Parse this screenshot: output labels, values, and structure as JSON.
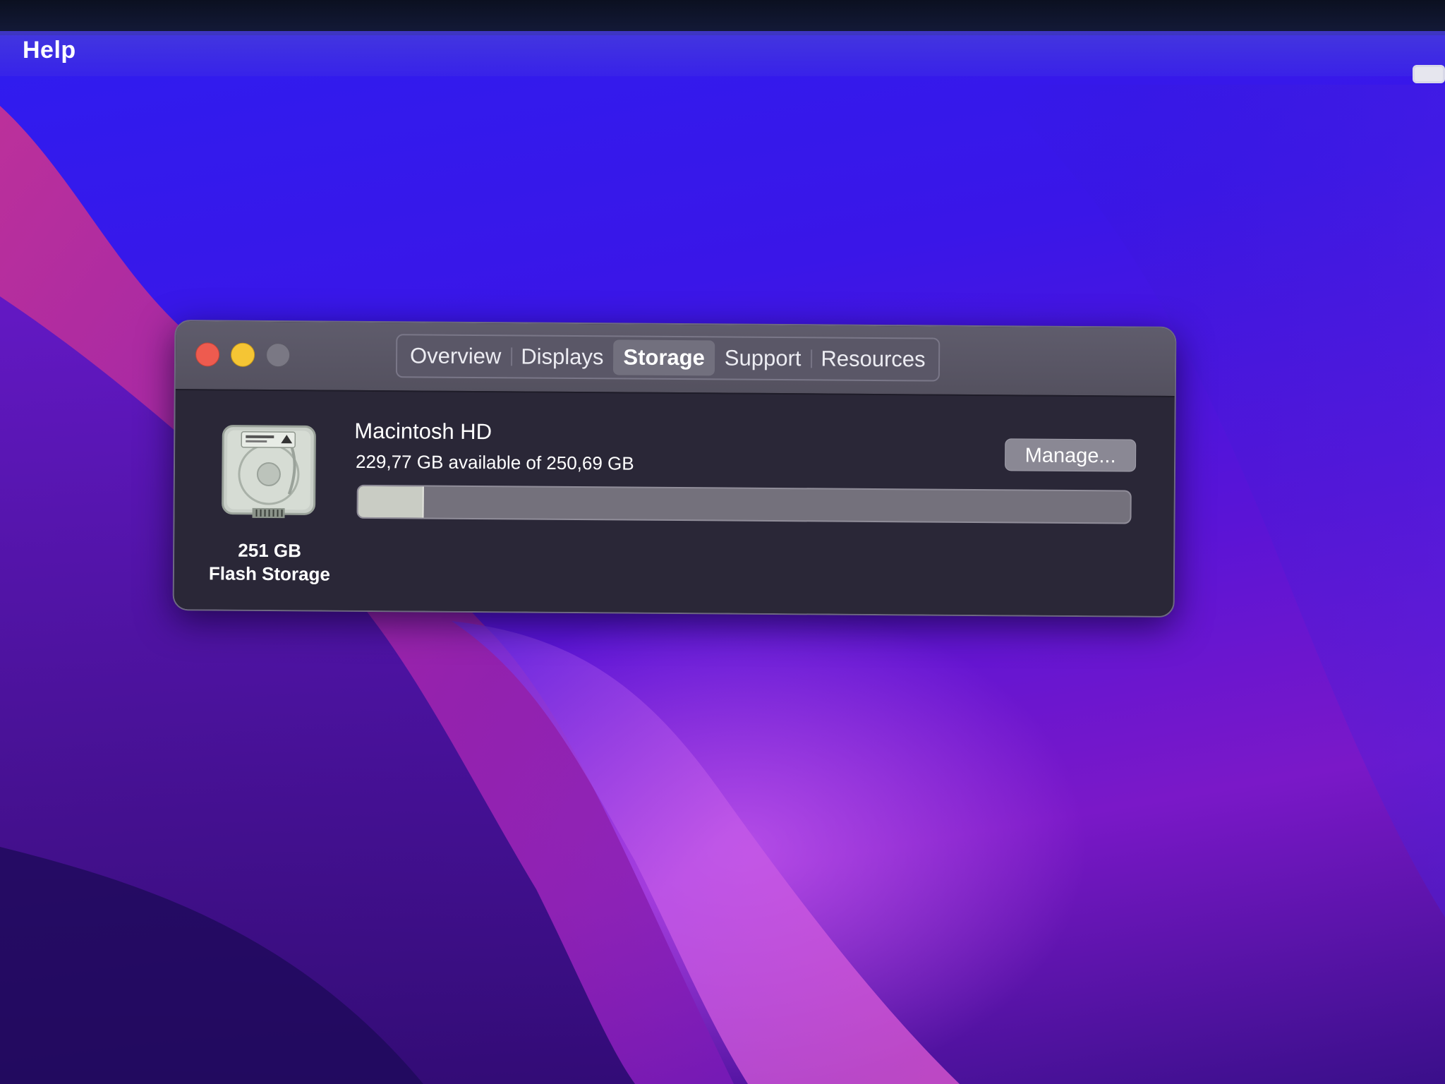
{
  "menubar": {
    "help_label": "Help"
  },
  "window": {
    "tabs": [
      {
        "label": "Overview",
        "active": false
      },
      {
        "label": "Displays",
        "active": false
      },
      {
        "label": "Storage",
        "active": true
      },
      {
        "label": "Support",
        "active": false
      },
      {
        "label": "Resources",
        "active": false
      }
    ],
    "traffic_lights": {
      "close_color": "#ee5b4f",
      "minimize_color": "#f5c534",
      "zoom_color": "#7a7884"
    }
  },
  "storage": {
    "disk_icon": "hard-drive-icon",
    "disk_capacity": "251 GB",
    "disk_type": "Flash Storage",
    "volume_name": "Macintosh HD",
    "availability": "229,77 GB available of 250,69 GB",
    "used_fraction": 0.0835,
    "manage_label": "Manage..."
  }
}
